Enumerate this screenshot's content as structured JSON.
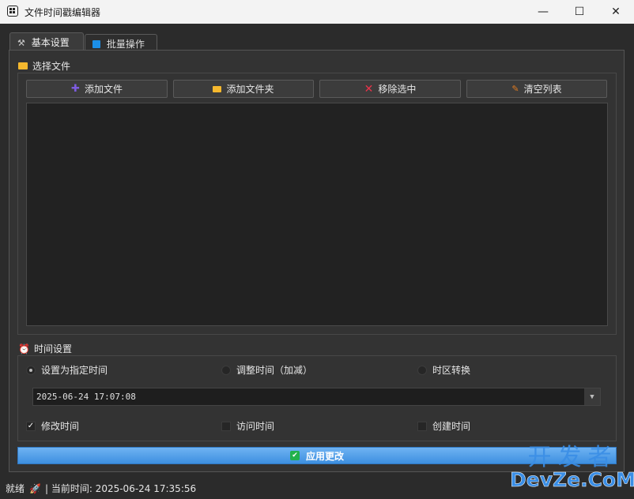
{
  "window": {
    "title": "文件时间戳编辑器",
    "minimize_icon": "—",
    "maximize_icon": "☐",
    "close_icon": "✕"
  },
  "tabs": [
    {
      "icon": "wrench-icon",
      "label": "基本设置",
      "active": true
    },
    {
      "icon": "grid-icon",
      "label": "批量操作",
      "active": false
    }
  ],
  "file_section": {
    "title": "选择文件",
    "buttons": [
      {
        "icon": "plus-icon",
        "glyph": "✚",
        "color": "#7d5ce0",
        "label": "添加文件"
      },
      {
        "icon": "folder-icon",
        "glyph": "▬",
        "color": "#f5b82e",
        "label": "添加文件夹"
      },
      {
        "icon": "cross-icon",
        "glyph": "✕",
        "color": "#e8334a",
        "label": "移除选中"
      },
      {
        "icon": "broom-icon",
        "glyph": "⸝",
        "color": "#e07a20",
        "label": "清空列表"
      }
    ],
    "files": []
  },
  "time_section": {
    "title": "时间设置",
    "modes": [
      {
        "label": "设置为指定时间",
        "checked": true
      },
      {
        "label": "调整时间（加减）",
        "checked": false
      },
      {
        "label": "时区转换",
        "checked": false
      }
    ],
    "datetime_value": "2025-06-24 17:07:08",
    "targets": [
      {
        "label": "修改时间",
        "checked": true
      },
      {
        "label": "访问时间",
        "checked": false
      },
      {
        "label": "创建时间",
        "checked": false
      }
    ]
  },
  "apply_button": {
    "label": "应用更改"
  },
  "status": {
    "ready": "就绪",
    "current_time_label": "| 当前时间: 2025-06-24 17:35:56"
  },
  "watermark": {
    "line1": "开发者",
    "line2": "DevZe.CoM"
  },
  "colors": {
    "accent": "#3d8fe0",
    "background": "#2b2b2b"
  }
}
